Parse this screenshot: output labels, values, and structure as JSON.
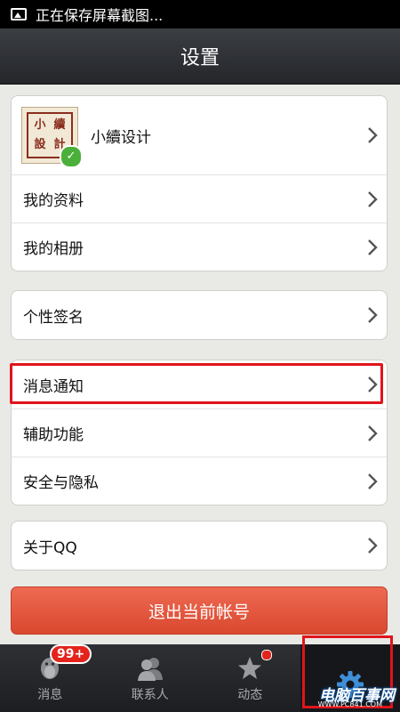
{
  "status_bar": {
    "text": "正在保存屏幕截图..."
  },
  "header": {
    "title": "设置"
  },
  "profile": {
    "name": "小續设计",
    "avatar_text": [
      "小",
      "續",
      "設",
      "計"
    ]
  },
  "groups": {
    "account": {
      "my_profile": "我的资料",
      "my_album": "我的相册"
    },
    "signature": {
      "label": "个性签名"
    },
    "settings": {
      "notifications": "消息通知",
      "accessibility": "辅助功能",
      "privacy": "安全与隐私"
    },
    "about": {
      "label": "关于QQ"
    }
  },
  "logout_button": "退出当前帐号",
  "tabs": {
    "messages": {
      "label": "消息",
      "badge": "99+"
    },
    "contacts": {
      "label": "联系人"
    },
    "feeds": {
      "label": "动态"
    }
  },
  "watermark": {
    "text": "电脑百事网",
    "sub": "WWW.PC841.COM"
  },
  "colors": {
    "highlight": "#e0141b",
    "logout": "#e55a40",
    "active_tab": "#3f8fd8"
  },
  "icons": {
    "status": "image-icon",
    "chevron": "chevron-right-icon",
    "messages": "penguin-icon",
    "contacts": "contacts-icon",
    "feeds": "star-icon",
    "settings": "gear-icon"
  }
}
